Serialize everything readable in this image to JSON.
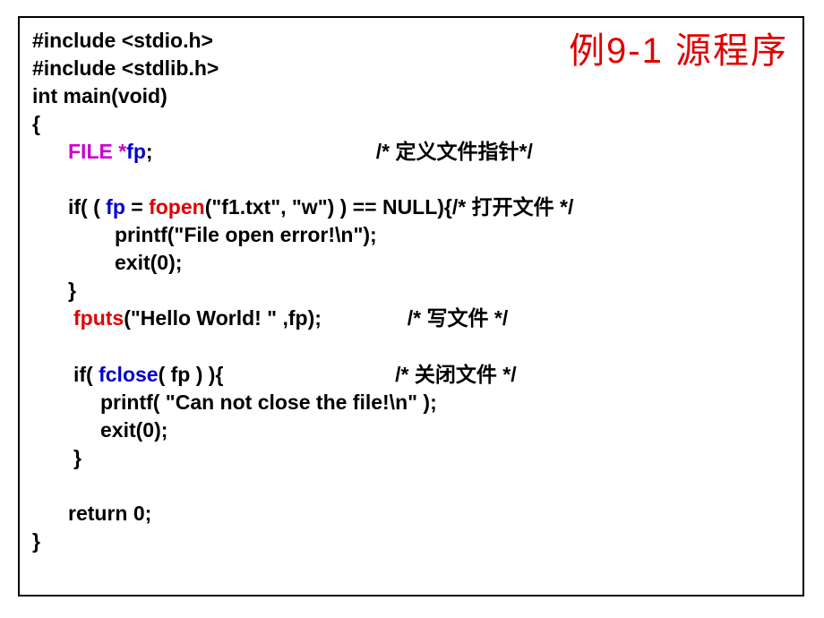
{
  "title": "例9-1  源程序",
  "code": {
    "l1": "#include <stdio.h>",
    "l2": "#include <stdlib.h>",
    "l3": "int main(void)",
    "l4": "{",
    "l5a": "FILE *",
    "l5b": "fp",
    "l5c": ";",
    "c5": "/* 定义文件指针*/",
    "l6a": "if( ( ",
    "l6b": "fp",
    "l6c": " = ",
    "l6d": "fopen",
    "l6e": "(\"f1.txt\", \"w\") ) == NULL){",
    "c6": "/* 打开文件 */",
    "l7": "printf(\"File open error!\\n\"); ",
    "l8": "exit(0);",
    "l9": "}",
    "l10a": "fputs",
    "l10b": "(\"Hello World! \" ,fp);",
    "c10": "/* 写文件 */",
    "l11a": "if( ",
    "l11b": "fclose",
    "l11c": "( fp ) ){",
    "c11": "/* 关闭文件 */",
    "l12": "printf( \"Can not close the file!\\n\" );",
    "l13": "exit(0);",
    "l14": "}",
    "l15": "return 0;",
    "l16": "}"
  }
}
